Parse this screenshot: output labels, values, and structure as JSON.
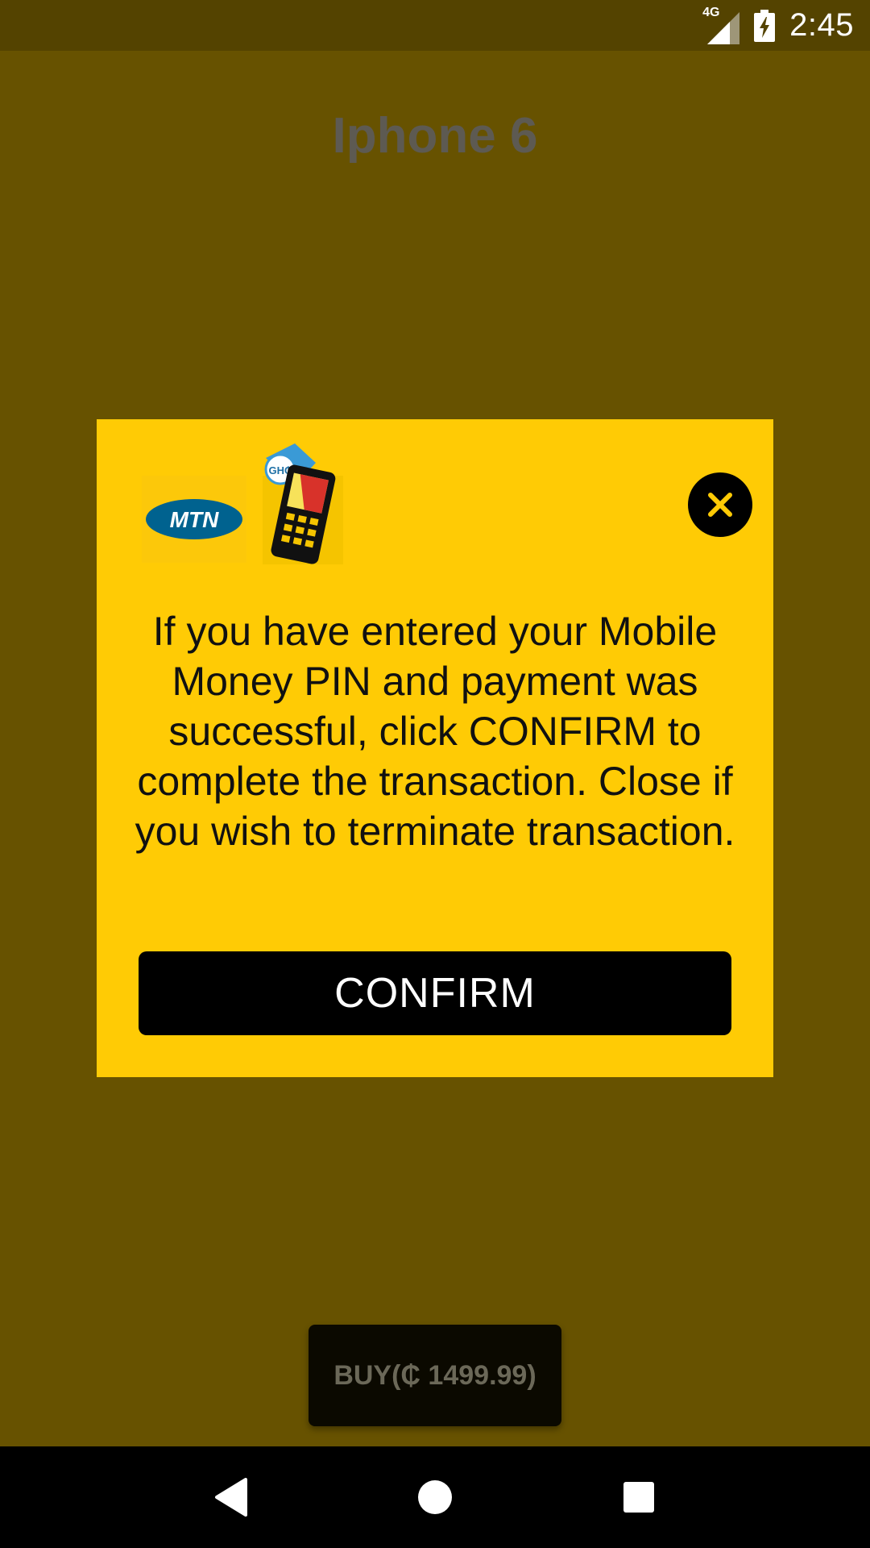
{
  "status_bar": {
    "network_label": "4G",
    "time": "2:45",
    "icons": [
      "signal-icon",
      "battery-charging-icon"
    ]
  },
  "product": {
    "title": "Iphone 6"
  },
  "buy_button": {
    "label": "BUY(₵ 1499.99)"
  },
  "dialog": {
    "logo_text": "MTN",
    "phone_tag": "GH₵",
    "message": "If you have entered your Mobile Money PIN and payment was successful, click CONFIRM to complete the transaction. Close if you wish to terminate transaction.",
    "confirm_label": "CONFIRM",
    "close_icon": "close-icon"
  },
  "nav_bar": {
    "icons": [
      "back-icon",
      "home-icon",
      "recents-icon"
    ]
  },
  "colors": {
    "brand_yellow": "#ffcb05",
    "mtn_blue": "#00628f",
    "scrim": "#675200"
  }
}
